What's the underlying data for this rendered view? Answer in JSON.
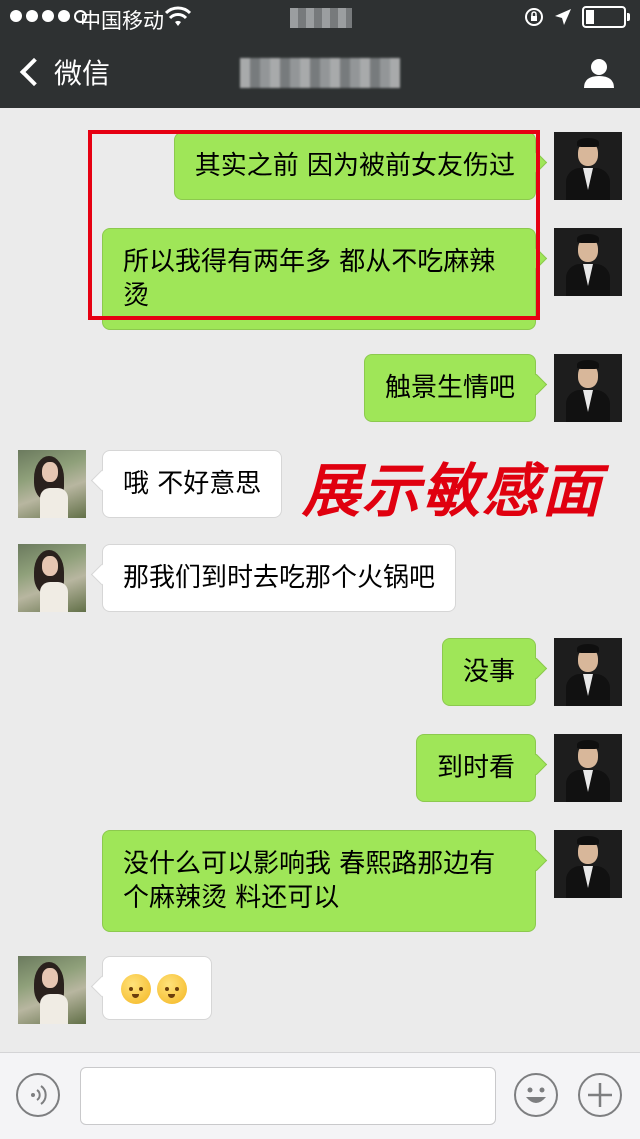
{
  "status_bar": {
    "carrier": "中国移动"
  },
  "nav": {
    "back_label": "微信"
  },
  "messages": [
    {
      "side": "right",
      "text": "其实之前 因为被前女友伤过"
    },
    {
      "side": "right",
      "text": "所以我得有两年多 都从不吃麻辣烫"
    },
    {
      "side": "right",
      "text": "触景生情吧"
    },
    {
      "side": "left",
      "text": "哦 不好意思"
    },
    {
      "side": "left",
      "text": "那我们到时去吃那个火锅吧"
    },
    {
      "side": "right",
      "text": "没事"
    },
    {
      "side": "right",
      "text": "到时看"
    },
    {
      "side": "right",
      "text": "没什么可以影响我 春熙路那边有个麻辣烫 料还可以"
    },
    {
      "side": "left",
      "text": "",
      "emoji": [
        "smile-emoji",
        "smile-emoji"
      ]
    }
  ],
  "annotation": {
    "text": "展示敏感面",
    "color": "#e0000f"
  },
  "colors": {
    "sent_bubble": "#9fe658",
    "received_bubble": "#ffffff",
    "nav_bg": "#2e3132",
    "chat_bg": "#ebebeb",
    "highlight_box": "#e60012"
  }
}
